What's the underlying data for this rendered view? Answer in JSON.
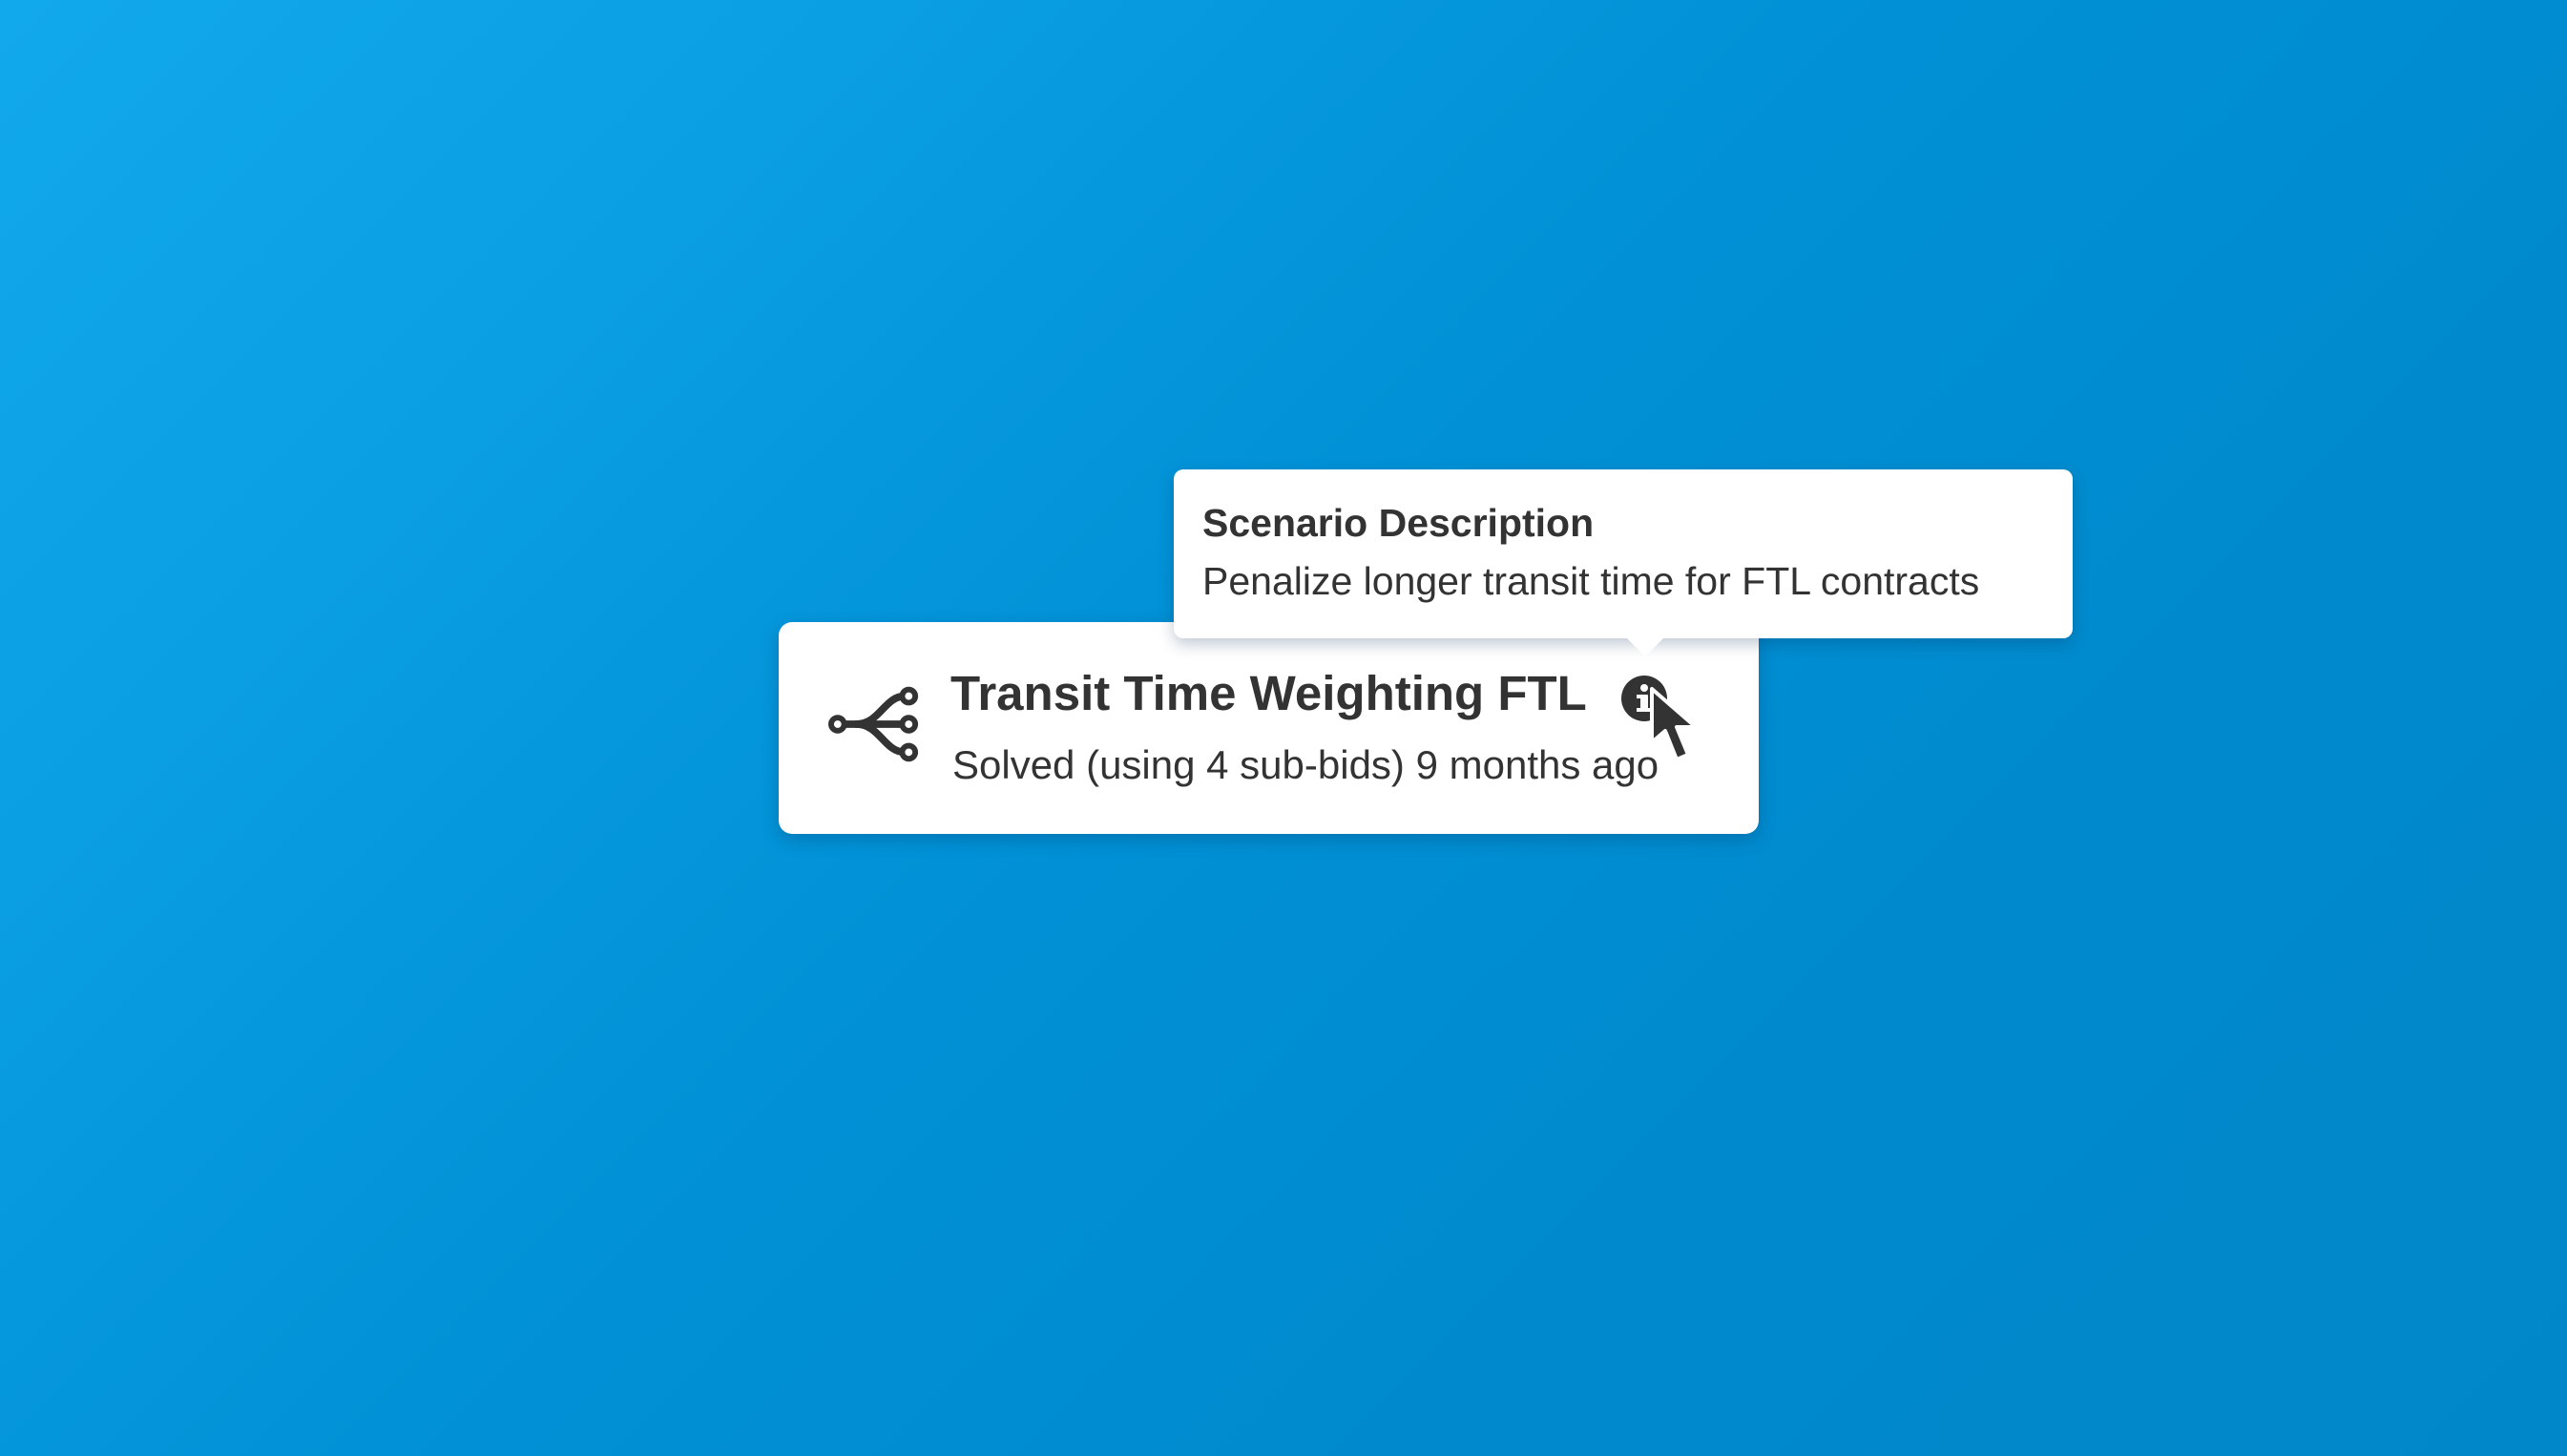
{
  "scenario_card": {
    "icon": "branch-fork-icon",
    "title": "Transit Time Weighting FTL",
    "status": "Solved (using 4 sub-bids) 9 months ago",
    "info_icon": "info-icon"
  },
  "tooltip": {
    "title": "Scenario Description",
    "description": "Penalize longer transit time for FTL contracts"
  },
  "colors": {
    "background": "#0a9ee2",
    "text": "#333333",
    "card": "#ffffff"
  }
}
